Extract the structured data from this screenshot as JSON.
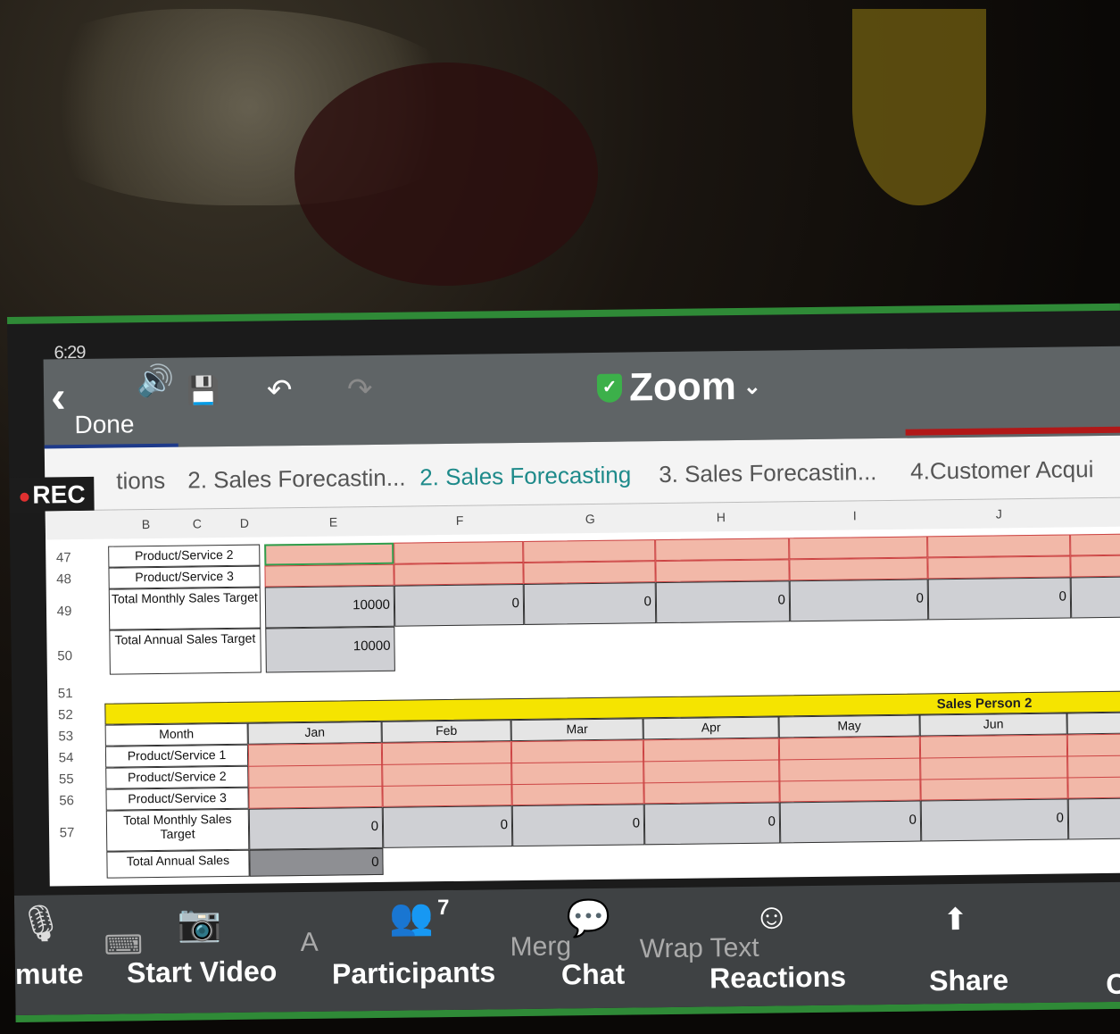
{
  "status": {
    "time": "6:29"
  },
  "topbar": {
    "back_label": "Done",
    "app_title": "Zoom"
  },
  "rec_label": "REC",
  "tabs": [
    {
      "label": "tions"
    },
    {
      "label": "2. Sales Forecastin..."
    },
    {
      "label": "2. Sales Forecasting"
    },
    {
      "label": "3. Sales Forecastin..."
    },
    {
      "label": "4.Customer Acqui"
    }
  ],
  "columns": [
    "B",
    "C",
    "D",
    "E",
    "F",
    "G",
    "H",
    "I",
    "J"
  ],
  "rows_top": {
    "r47": {
      "num": "47",
      "label": "Product/Service 2"
    },
    "r48": {
      "num": "48",
      "label": "Product/Service 3"
    },
    "r49": {
      "num": "49",
      "label": "Total Monthly Sales Target",
      "values": [
        "10000",
        "0",
        "0",
        "0",
        "0",
        "0"
      ]
    },
    "r50": {
      "num": "50",
      "label": "Total Annual Sales Target",
      "value": "10000"
    }
  },
  "row_nums_mid": [
    "51",
    "52",
    "53",
    "54",
    "55",
    "56",
    "57"
  ],
  "section2": {
    "title": "Sales Person 2",
    "month_label": "Month",
    "months": [
      "Jan",
      "Feb",
      "Mar",
      "Apr",
      "May",
      "Jun"
    ],
    "p1": "Product/Service 1",
    "p2": "Product/Service 2",
    "p3": "Product/Service 3",
    "total_label": "Total Monthly Sales Target",
    "totals": [
      "0",
      "0",
      "0",
      "0",
      "0",
      "0"
    ],
    "annual_label": "Total Annual Sales",
    "annual_value": "0"
  },
  "bottom": {
    "mute": "mute",
    "start_video": "Start Video",
    "participants": "Participants",
    "participants_count": "7",
    "merge_ghost": "Merg",
    "chat": "Chat",
    "wrap_ghost": "Wrap Text",
    "reactions": "Reactions",
    "share": "Share",
    "more": "C"
  }
}
